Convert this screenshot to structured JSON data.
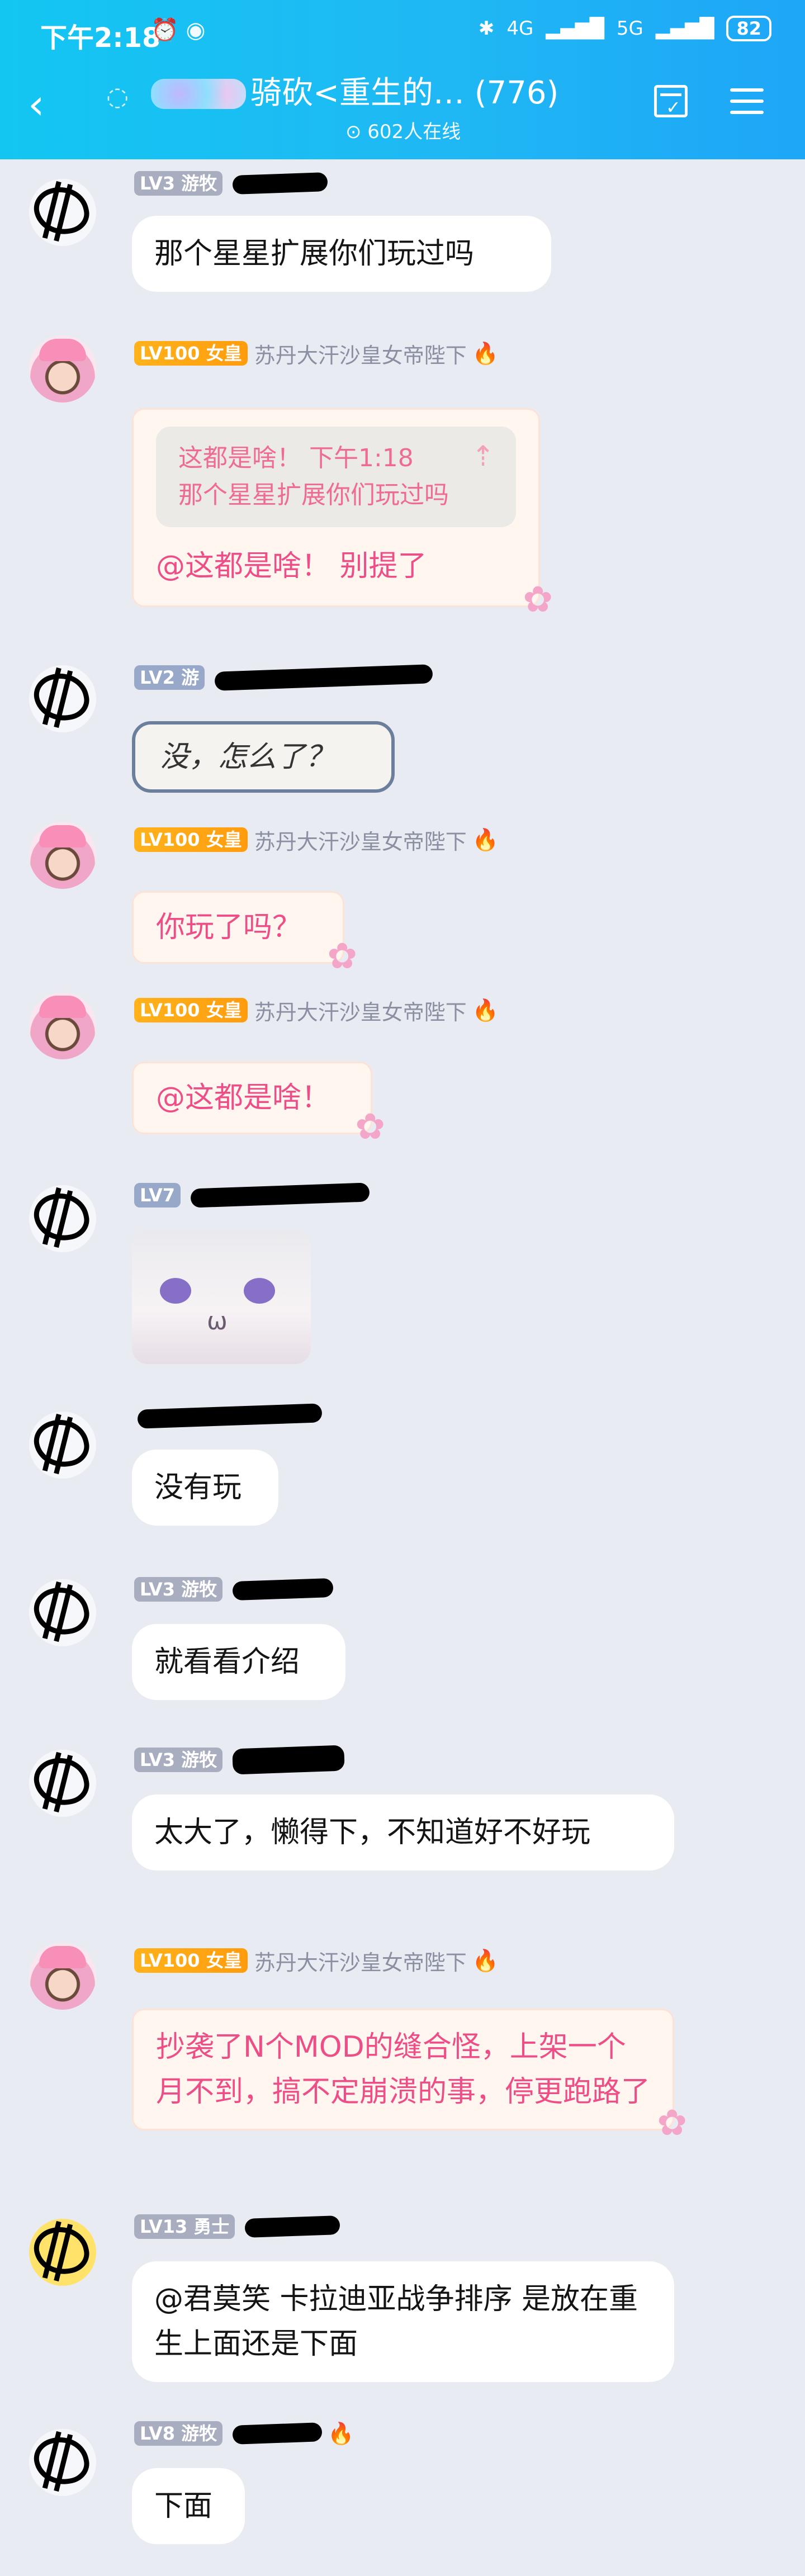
{
  "status": {
    "time": "下午2:18",
    "battery": "82",
    "network_left": "4G",
    "network_right": "5G"
  },
  "header": {
    "title": "骑砍<重生的…  (776)",
    "online": "602人在线"
  },
  "messages": [
    {
      "level": "LV3",
      "title": "游牧",
      "text": "那个星星扩展你们玩过吗"
    },
    {
      "level": "LV100",
      "title": "女皇",
      "name": "苏丹大汗沙皇女帝陛下",
      "quote_head": "这都是啥！  下午1:18",
      "quote_body": "那个星星扩展你们玩过吗",
      "text": "@这都是啥！   别提了"
    },
    {
      "level": "LV2",
      "title": "游",
      "text": "没，怎么了？"
    },
    {
      "level": "LV100",
      "title": "女皇",
      "name": "苏丹大汗沙皇女帝陛下",
      "text": "你玩了吗？"
    },
    {
      "level": "LV100",
      "title": "女皇",
      "name": "苏丹大汗沙皇女帝陛下",
      "text": "@这都是啥！"
    },
    {
      "level": "LV7",
      "title": ""
    },
    {
      "level": "",
      "title": "",
      "text": "没有玩"
    },
    {
      "level": "LV3",
      "title": "游牧",
      "text": "就看看介绍"
    },
    {
      "level": "LV3",
      "title": "游牧",
      "text": "太大了，懒得下，不知道好不好玩"
    },
    {
      "level": "LV100",
      "title": "女皇",
      "name": "苏丹大汗沙皇女帝陛下",
      "text": "抄袭了N个MOD的缝合怪，上架一个月不到，搞不定崩溃的事，停更跑路了"
    },
    {
      "level": "LV13",
      "title": "勇士",
      "text": "@君莫笑 卡拉迪亚战争排序 是放在重生上面还是下面"
    },
    {
      "level": "LV8",
      "title": "游牧",
      "text": "下面"
    }
  ]
}
